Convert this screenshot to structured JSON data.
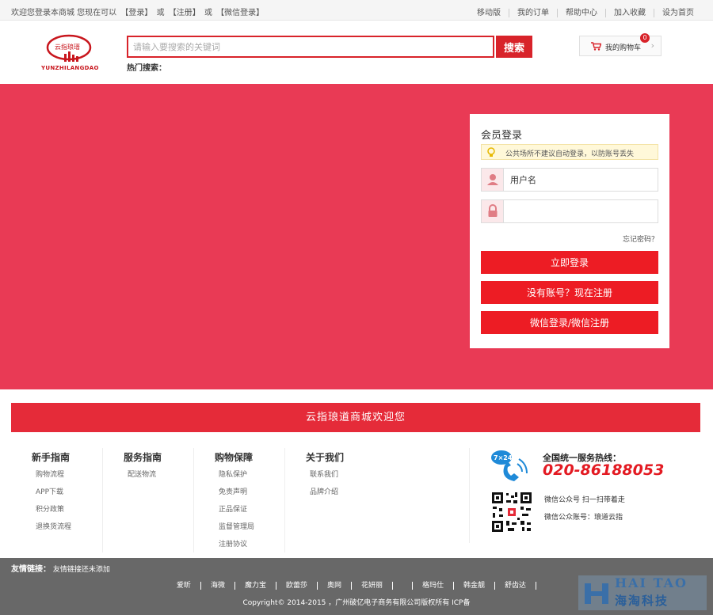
{
  "topbar": {
    "welcome_prefix": "欢迎您登录本商城 您现在可以",
    "login": "【登录】",
    "or1": "或",
    "register": "【注册】",
    "or2": "或",
    "wechat_login": "【微信登录】",
    "links": [
      "移动版",
      "我的订单",
      "帮助中心",
      "加入收藏",
      "设为首页"
    ]
  },
  "header": {
    "logo_text": "YUNZHILANGDAO",
    "logo_mark": "云指琅瑨",
    "search_placeholder": "请输入要搜索的关键词",
    "search_button": "搜索",
    "hot_search": "热门搜索：",
    "cart_label": "我的购物车",
    "cart_count": "0"
  },
  "login": {
    "title": "会员登录",
    "tip": "公共场所不建议自动登录，以防账号丢失",
    "username_value": "用户名",
    "password_value": "",
    "forgot": "忘记密码？",
    "login_button": "立即登录",
    "register_button": "没有账号？现在注册",
    "wechat_button": "微信登录/微信注册"
  },
  "welcome_bar": "云指琅道商城欢迎您",
  "guides": [
    {
      "title": "新手指南",
      "items": [
        "购物流程",
        "APP下载",
        "积分政策",
        "退换货流程"
      ]
    },
    {
      "title": "服务指南",
      "items": [
        "配送物流"
      ]
    },
    {
      "title": "购物保障",
      "items": [
        "隐私保护",
        "免责声明",
        "正品保证",
        "监督管理局",
        "注册协议"
      ]
    },
    {
      "title": "关于我们",
      "items": [
        "联系我们",
        "品牌介绍"
      ]
    }
  ],
  "hotline": {
    "badge": "7×24",
    "title": "全国统一服务热线：",
    "number": "020-86188053",
    "wechat_scan": "微信公众号 扫一扫带着走",
    "wechat_account": "微信公众账号：琅道云指"
  },
  "footer": {
    "friend_label": "友情链接：",
    "friend_text": "友情链接还未添加",
    "brands": [
      "爱昕",
      "海微",
      "魔力宝",
      "欧蕾莎",
      "奥网",
      "花妍丽",
      "",
      "格玛仕",
      "韩金靓",
      "舒齿达"
    ],
    "copyright": "Copyright© 2014-2015 ，广州破亿电子商务有限公司版权所有 ICP备"
  },
  "watermark": {
    "en": "HAI TAO",
    "cn": "海淘科技"
  },
  "colors": {
    "brand_red": "#d8232a",
    "banner": "#e93a55",
    "button_red": "#ed1c24",
    "footer_bg": "#686868"
  }
}
